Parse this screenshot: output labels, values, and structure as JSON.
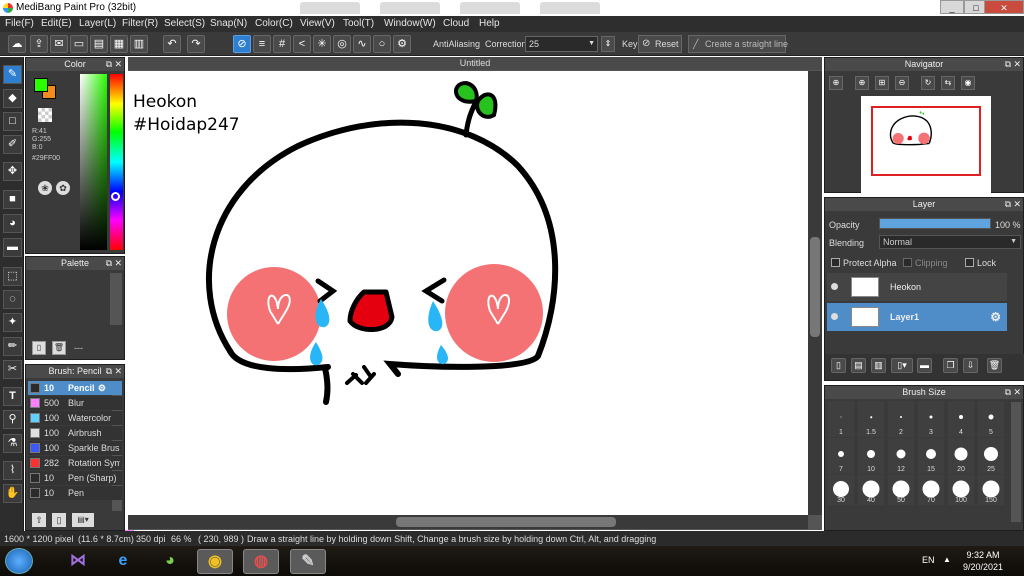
{
  "window": {
    "title": "MediBang Paint Pro (32bit)",
    "min": "_",
    "max": "□",
    "close": "✕"
  },
  "menu": [
    "File(F)",
    "Edit(E)",
    "Layer(L)",
    "Filter(R)",
    "Select(S)",
    "Snap(N)",
    "Color(C)",
    "View(V)",
    "Tool(T)",
    "Window(W)",
    "Cloud",
    "Help"
  ],
  "toolbar": {
    "antialiasing_label": "AntiAliasing",
    "antialiasing_checked": true,
    "correction_label": "Correction",
    "correction_value": "25",
    "key_label": "Key",
    "reset_label": "Reset",
    "straight_line_label": "Create a straight line"
  },
  "color_panel": {
    "title": "Color",
    "fg_color": "#29FF00",
    "bg_color": "#F28C1E",
    "r": "R:41",
    "g": "G:255",
    "b": "B:0",
    "hex": "#29FF00"
  },
  "palette_panel": {
    "title": "Palette",
    "extra": "---",
    "colors": [
      "#c8c8c8",
      "#ffffff",
      "#ff9ecf",
      "#a0ff80",
      "#40ff40",
      "#80ffff",
      "#a0a0ff",
      "#ff80ff",
      "#ff8080",
      "#ffb080",
      "#ffff80",
      "#80ff80",
      "#40c0ff",
      "#4040ff",
      "#c040ff",
      "#ff4040",
      "#e040c0",
      "#ff60a0",
      "#808080",
      "#000000",
      "#ffff00",
      "#ff0000",
      "#e02020",
      "#c06020",
      "#ff8000",
      "#00c0c0",
      "#408040",
      "#00a0ff",
      "#ff60ff",
      "#c0c0c0",
      "#60a060",
      "#a0a0a0"
    ]
  },
  "brush_panel": {
    "title": "Brush: Pencil",
    "items": [
      {
        "size": "10",
        "name": "Pencil",
        "color": "#2b2b2b",
        "selected": true
      },
      {
        "size": "500",
        "name": "Blur",
        "color": "#ff80ff",
        "selected": false
      },
      {
        "size": "100",
        "name": "Watercolor",
        "color": "#60d0ff",
        "selected": false
      },
      {
        "size": "100",
        "name": "Airbrush",
        "color": "#e0e0e0",
        "selected": false
      },
      {
        "size": "100",
        "name": "Sparkle Brush",
        "color": "#3a5aff",
        "selected": false
      },
      {
        "size": "282",
        "name": "Rotation Symmetry",
        "color": "#ff3030",
        "selected": false
      },
      {
        "size": "10",
        "name": "Pen (Sharp)",
        "color": "#2b2b2b",
        "selected": false
      },
      {
        "size": "10",
        "name": "Pen",
        "color": "#2b2b2b",
        "selected": false
      }
    ]
  },
  "canvas": {
    "title": "Untitled",
    "text_line1": "Heokon",
    "text_line2": "#Hoidap247"
  },
  "navigator": {
    "title": "Navigator"
  },
  "layer_panel": {
    "title": "Layer",
    "opacity_label": "Opacity",
    "opacity_value": "100 %",
    "opacity_fraction": 1.0,
    "blending_label": "Blending",
    "blending_value": "Normal",
    "protect_alpha": "Protect Alpha",
    "clipping": "Clipping",
    "lock": "Lock",
    "layers": [
      {
        "name": "Heokon",
        "selected": false
      },
      {
        "name": "Layer1",
        "selected": true
      }
    ]
  },
  "brush_size_panel": {
    "title": "Brush Size",
    "sizes": [
      "1",
      "1.5",
      "2",
      "3",
      "4",
      "5",
      "7",
      "10",
      "12",
      "15",
      "20",
      "25",
      "30",
      "40",
      "50",
      "70",
      "100",
      "150"
    ]
  },
  "status": {
    "dimensions": "1600 * 1200 pixel",
    "cm": "(11.6 * 8.7cm)",
    "dpi": "350 dpi",
    "zoom": "66 %",
    "coords": "( 230, 989 )",
    "hint": "Draw a straight line by holding down Shift, Change a brush size by holding down Ctrl, Alt, and dragging"
  },
  "taskbar": {
    "lang": "EN",
    "time": "9:32 AM",
    "date": "9/20/2021"
  }
}
